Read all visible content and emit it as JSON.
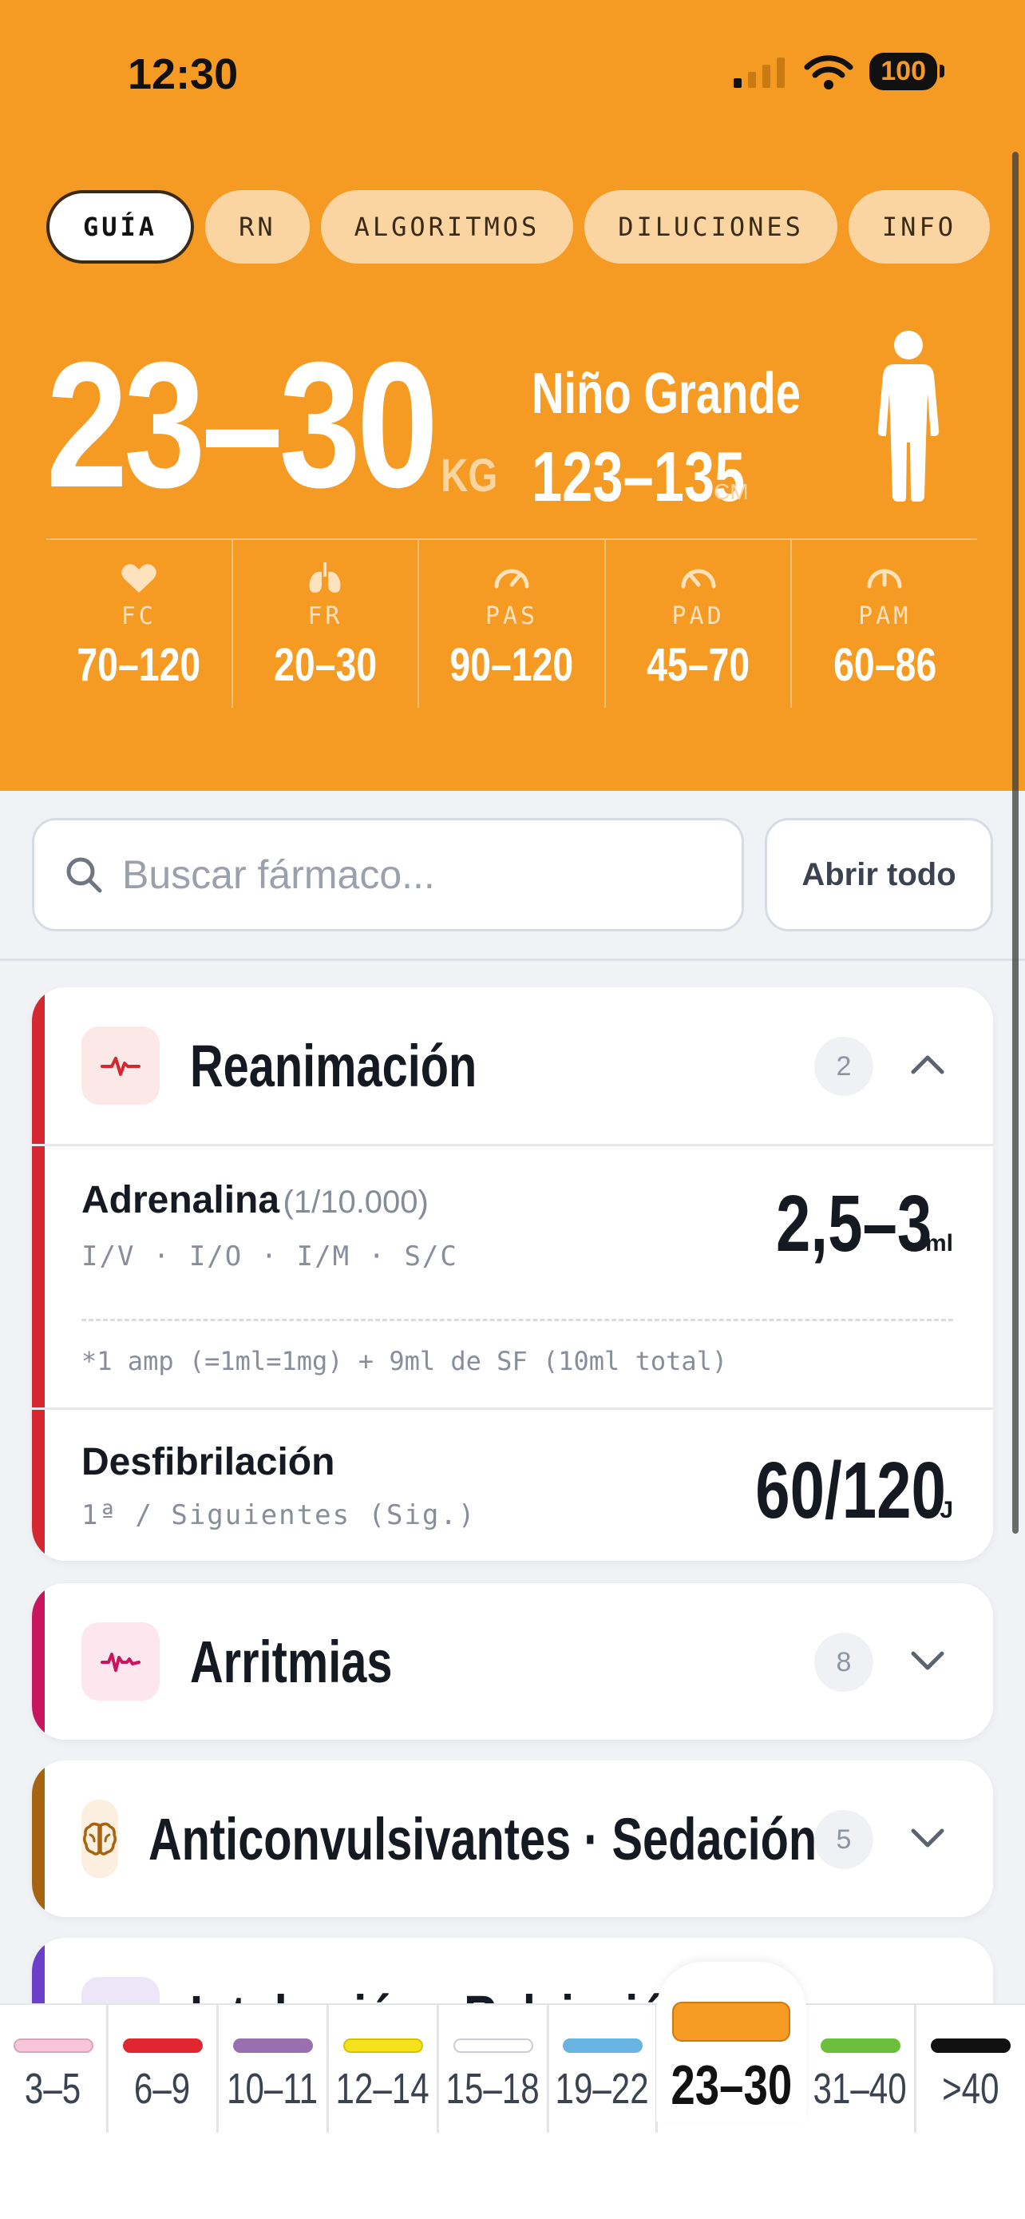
{
  "status_bar": {
    "time": "12:30",
    "battery": "100"
  },
  "tabs": [
    {
      "label": "GUÍA",
      "active": true
    },
    {
      "label": "RN",
      "active": false
    },
    {
      "label": "ALGORITMOS",
      "active": false
    },
    {
      "label": "DILUCIONES",
      "active": false
    },
    {
      "label": "INFO",
      "active": false
    }
  ],
  "patient": {
    "weight_range": "23–30",
    "weight_unit": "KG",
    "age_group": "Niño Grande",
    "height_range": "123–135",
    "height_unit": "CM"
  },
  "vitals": [
    {
      "icon": "heart-icon",
      "label": "FC",
      "value": "70–120"
    },
    {
      "icon": "lungs-icon",
      "label": "FR",
      "value": "20–30"
    },
    {
      "icon": "gauge-icon",
      "label": "PAS",
      "value": "90–120"
    },
    {
      "icon": "gauge-icon",
      "label": "PAD",
      "value": "45–70"
    },
    {
      "icon": "gauge-icon",
      "label": "PAM",
      "value": "60–86"
    }
  ],
  "search": {
    "placeholder": "Buscar fármaco..."
  },
  "open_all_label": "Abrir todo",
  "categories": [
    {
      "title": "Reanimación",
      "count": "2",
      "expanded": true,
      "accent": "#d6262f",
      "drugs": [
        {
          "name": "Adrenalina",
          "detail": "(1/10.000)",
          "routes": "I/V · I/O · I/M · S/C",
          "dose": "2,5–3",
          "unit": "ml",
          "note": "*1 amp (=1ml=1mg) + 9ml de SF (10ml total)"
        },
        {
          "name": "Desfibrilación",
          "routes": "1ª / Siguientes (Sig.)",
          "dose": "60/120",
          "unit": "J"
        }
      ]
    },
    {
      "title": "Arritmias",
      "count": "8",
      "expanded": false,
      "accent": "#c8155e"
    },
    {
      "title": "Anticonvulsivantes · Sedación",
      "count": "5",
      "expanded": false,
      "accent": "#a76410"
    },
    {
      "title": "Intubación · Relajación",
      "expanded": false,
      "accent": "#6a3fc9"
    }
  ],
  "weight_bands": [
    {
      "label": "3–5",
      "color": "#f8c6d8"
    },
    {
      "label": "6–9",
      "color": "#e0262f"
    },
    {
      "label": "10–11",
      "color": "#9a6fb0"
    },
    {
      "label": "12–14",
      "color": "#f5e11c"
    },
    {
      "label": "15–18",
      "color": "#ffffff"
    },
    {
      "label": "19–22",
      "color": "#6ab4e4"
    },
    {
      "label": "23–30",
      "color": "#f59b23",
      "active": true
    },
    {
      "label": "31–40",
      "color": "#6cbf3c"
    },
    {
      "label": ">40",
      "color": "#111111"
    }
  ]
}
